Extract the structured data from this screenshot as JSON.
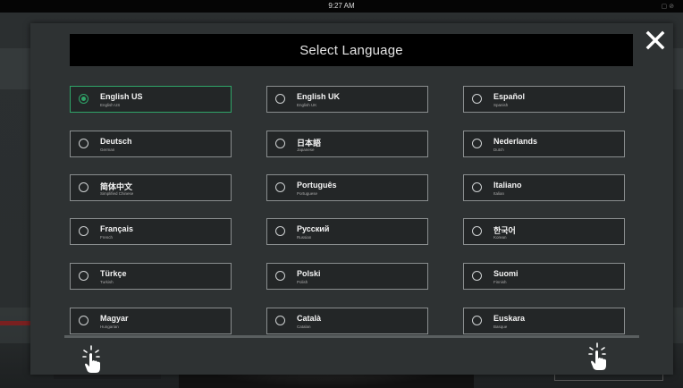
{
  "status_bar": {
    "time": "9:27 AM"
  },
  "dialog": {
    "title": "Select Language",
    "close_symbol": "✕",
    "selected_index": 0,
    "accent_color": "#2fa569",
    "options": [
      {
        "name": "English US",
        "sub": "English US"
      },
      {
        "name": "English UK",
        "sub": "English UK"
      },
      {
        "name": "Español",
        "sub": "Spanish"
      },
      {
        "name": "Deutsch",
        "sub": "German"
      },
      {
        "name": "日本語",
        "sub": "Japanese"
      },
      {
        "name": "Nederlands",
        "sub": "Dutch"
      },
      {
        "name": "简体中文",
        "sub": "Simplified Chinese"
      },
      {
        "name": "Português",
        "sub": "Portuguese"
      },
      {
        "name": "Italiano",
        "sub": "Italian"
      },
      {
        "name": "Français",
        "sub": "French"
      },
      {
        "name": "Русский",
        "sub": "Russian"
      },
      {
        "name": "한국어",
        "sub": "Korean"
      },
      {
        "name": "Türkçe",
        "sub": "Turkish"
      },
      {
        "name": "Polski",
        "sub": "Polish"
      },
      {
        "name": "Suomi",
        "sub": "Finnish"
      },
      {
        "name": "Magyar",
        "sub": "Hungarian"
      },
      {
        "name": "Català",
        "sub": "Catalan"
      },
      {
        "name": "Euskara",
        "sub": "Basque"
      }
    ]
  },
  "icons": {
    "close": "close-icon",
    "tap_hint_left": "tap-hand-icon",
    "tap_hint_right": "tap-hand-icon"
  }
}
